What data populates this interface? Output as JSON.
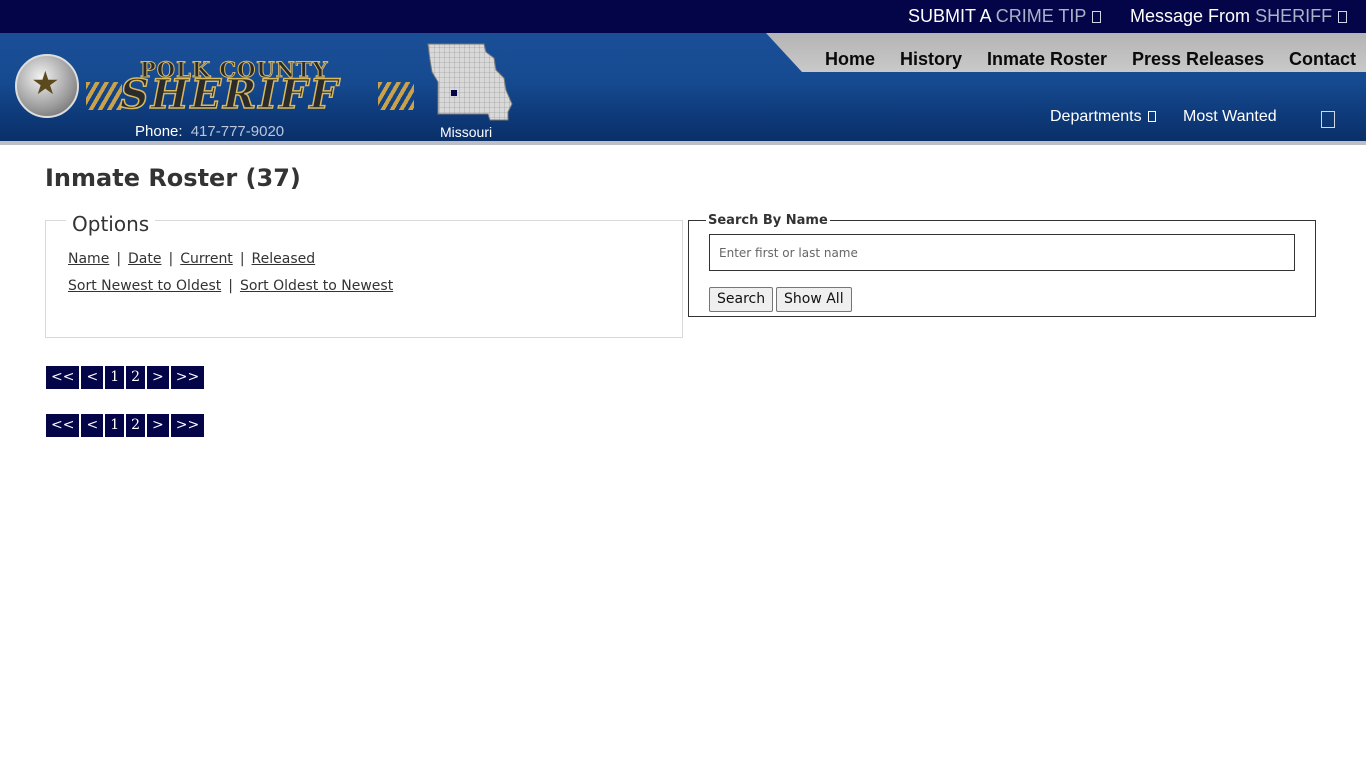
{
  "topbar": {
    "crime_tip_prefix": "SUBMIT A",
    "crime_tip_highlight": "CRIME TIP",
    "message_prefix": "Message From",
    "message_highlight": "SHERIFF"
  },
  "logo": {
    "county": "POLK COUNTY",
    "sheriff": "SHERIFF",
    "phone_label": "Phone:",
    "phone_number": "417-777-9020",
    "state": "Missouri"
  },
  "nav": {
    "home": "Home",
    "history": "History",
    "inmate_roster": "Inmate Roster",
    "press_releases": "Press Releases",
    "contact": "Contact",
    "departments": "Departments",
    "most_wanted": "Most Wanted"
  },
  "main": {
    "title": "Inmate Roster (37)",
    "options": {
      "legend": "Options",
      "sort_by": [
        "Name",
        "Date",
        "Current",
        "Released"
      ],
      "order": [
        "Sort Newest to Oldest",
        "Sort Oldest to Newest"
      ]
    },
    "search": {
      "legend": "Search By Name",
      "placeholder": "Enter first or last name",
      "search_label": "Search",
      "show_all_label": "Show All"
    },
    "pagination": [
      "<<",
      "<",
      "1",
      "2",
      ">",
      ">>"
    ]
  },
  "colors": {
    "topbar": "#040448",
    "header_blue": "#164a90",
    "nav_tab": "#c0c0c0",
    "pager_bg": "#040448"
  },
  "icons": {
    "topbar_arrow": "square-icon",
    "menu": "hamburger-menu-icon"
  }
}
